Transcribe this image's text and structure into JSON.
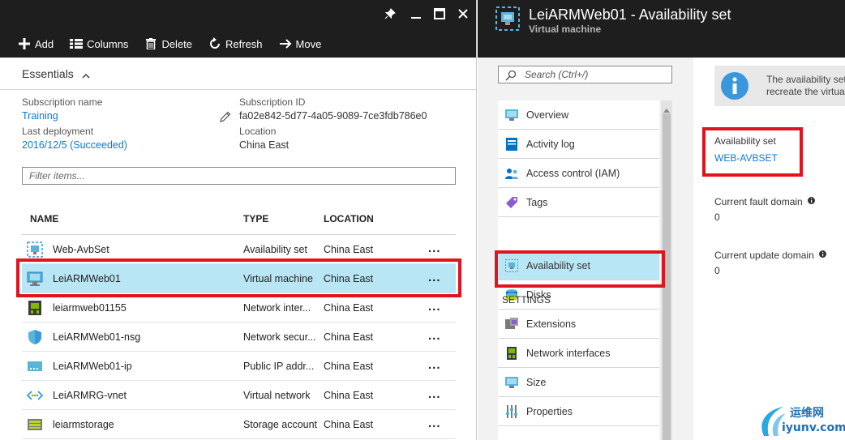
{
  "left_blade": {
    "toolbar": {
      "add": "Add",
      "columns": "Columns",
      "delete": "Delete",
      "refresh": "Refresh",
      "move": "Move"
    },
    "essentials": {
      "title": "Essentials",
      "subscription_name_label": "Subscription name",
      "subscription_name": "Training",
      "last_deployment_label": "Last deployment",
      "last_deployment": "2016/12/5 (Succeeded)",
      "subscription_id_label": "Subscription ID",
      "subscription_id": "fa02e842-5d77-4a05-9089-7ce3fdb786e0",
      "location_label": "Location",
      "location": "China East"
    },
    "filter_placeholder": "Filter items...",
    "columns": {
      "name": "NAME",
      "type": "TYPE",
      "location": "LOCATION"
    },
    "rows": [
      {
        "name": "Web-AvbSet",
        "type": "Availability set",
        "location": "China East",
        "more": "...",
        "icon": "availability-set-icon",
        "selected": false
      },
      {
        "name": "LeiARMWeb01",
        "type": "Virtual machine",
        "location": "China East",
        "more": "...",
        "icon": "virtual-machine-icon",
        "selected": true
      },
      {
        "name": "leiarmweb01155",
        "type": "Network inter...",
        "location": "China East",
        "more": "...",
        "icon": "network-interface-icon",
        "selected": false
      },
      {
        "name": "LeiARMWeb01-nsg",
        "type": "Network secur...",
        "location": "China East",
        "more": "...",
        "icon": "shield-icon",
        "selected": false
      },
      {
        "name": "LeiARMWeb01-ip",
        "type": "Public IP addr...",
        "location": "China East",
        "more": "...",
        "icon": "public-ip-icon",
        "selected": false
      },
      {
        "name": "LeiARMRG-vnet",
        "type": "Virtual network",
        "location": "China East",
        "more": "...",
        "icon": "virtual-network-icon",
        "selected": false
      },
      {
        "name": "leiarmstorage",
        "type": "Storage account",
        "location": "China East",
        "more": "...",
        "icon": "storage-account-icon",
        "selected": false
      }
    ]
  },
  "right_blade": {
    "title": "LeiARMWeb01 - Availability set",
    "subtitle": "Virtual machine",
    "search_placeholder": "Search (Ctrl+/)",
    "menu_top": [
      {
        "label": "Overview",
        "icon": "overview-icon"
      },
      {
        "label": "Activity log",
        "icon": "activity-log-icon"
      },
      {
        "label": "Access control (IAM)",
        "icon": "access-control-icon"
      },
      {
        "label": "Tags",
        "icon": "tag-icon"
      }
    ],
    "settings_heading": "SETTINGS",
    "menu_settings": [
      {
        "label": "Availability set",
        "icon": "availability-set-icon",
        "selected": true
      },
      {
        "label": "Disks",
        "icon": "disks-icon"
      },
      {
        "label": "Extensions",
        "icon": "extensions-icon"
      },
      {
        "label": "Network interfaces",
        "icon": "network-interface-icon"
      },
      {
        "label": "Size",
        "icon": "size-icon"
      },
      {
        "label": "Properties",
        "icon": "properties-icon"
      }
    ],
    "detail": {
      "info_line1": "The availability set",
      "info_line2": "recreate the virtua",
      "availability_set_label": "Availability set",
      "availability_set_value": "WEB-AVBSET",
      "fault_domain_label": "Current fault domain",
      "fault_domain_value": "0",
      "update_domain_label": "Current update domain",
      "update_domain_value": "0"
    }
  },
  "watermark": {
    "line1": "运维网",
    "line2": "iyunv.com"
  },
  "colors": {
    "accent": "#0a7bd3",
    "selected": "#b8e6f5",
    "highlight": "#e0141e",
    "header": "#1e1e1e"
  }
}
